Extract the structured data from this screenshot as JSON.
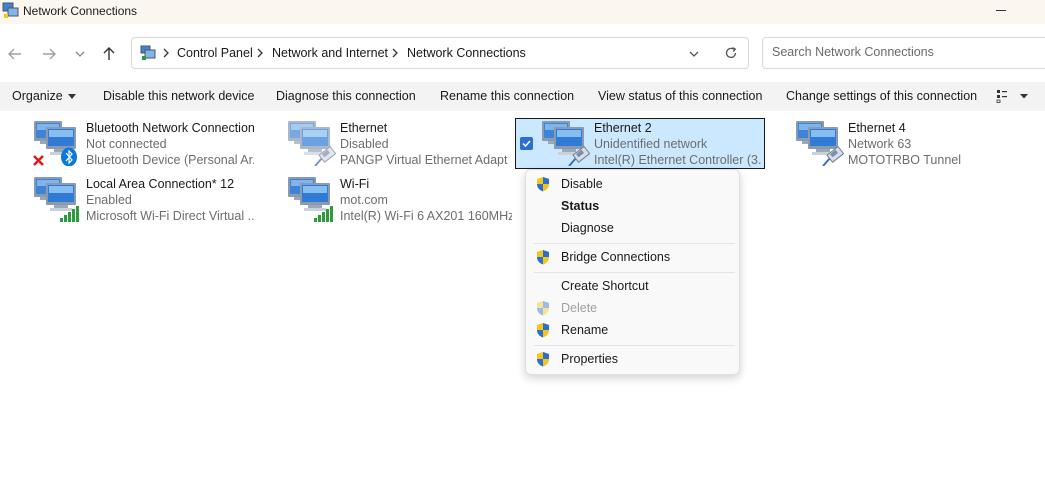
{
  "window": {
    "title": "Network Connections"
  },
  "address": {
    "crumbs": [
      "Control Panel",
      "Network and Internet",
      "Network Connections"
    ]
  },
  "search": {
    "placeholder": "Search Network Connections"
  },
  "commands": {
    "organize": "Organize",
    "disable": "Disable this network device",
    "diagnose": "Diagnose this connection",
    "rename": "Rename this connection",
    "view_status": "View status of this connection",
    "change_settings": "Change settings of this connection"
  },
  "connections": [
    {
      "name": "Bluetooth Network Connection",
      "status": "Not connected",
      "device": "Bluetooth Device (Personal Ar...",
      "icon": "bluetooth-network-icon"
    },
    {
      "name": "Ethernet",
      "status": "Disabled",
      "device": "PANGP Virtual Ethernet Adapt...",
      "icon": "ethernet-network-icon"
    },
    {
      "name": "Ethernet 2",
      "status": "Unidentified network",
      "device": "Intel(R) Ethernet Controller (3...",
      "icon": "ethernet-network-icon",
      "selected": true
    },
    {
      "name": "Ethernet 4",
      "status": "Network 63",
      "device": "MOTOTRBO Tunnel",
      "icon": "ethernet-network-icon"
    },
    {
      "name": "Local Area Connection* 12",
      "status": "Enabled",
      "device": "Microsoft Wi-Fi Direct Virtual ...",
      "icon": "wifi-network-icon"
    },
    {
      "name": "Wi-Fi",
      "status": "mot.com",
      "device": "Intel(R) Wi-Fi 6 AX201 160MHz",
      "icon": "wifi-network-icon"
    }
  ],
  "context_menu": {
    "items": [
      {
        "label": "Disable",
        "shield": true
      },
      {
        "label": "Status",
        "bold": true
      },
      {
        "label": "Diagnose"
      },
      {
        "label": "Bridge Connections",
        "shield": true
      },
      {
        "label": "Create Shortcut"
      },
      {
        "label": "Delete",
        "shield": true,
        "disabled": true
      },
      {
        "label": "Rename",
        "shield": true
      },
      {
        "label": "Properties",
        "shield": true
      }
    ]
  },
  "colors": {
    "selection": "#cce8ff",
    "command_bar": "#f3f3f3",
    "titlebar": "#fbf7f0",
    "wifi_bars": "#2d9a3c",
    "error_x": "#d81e1e",
    "bluetooth": "#0a78d7"
  }
}
